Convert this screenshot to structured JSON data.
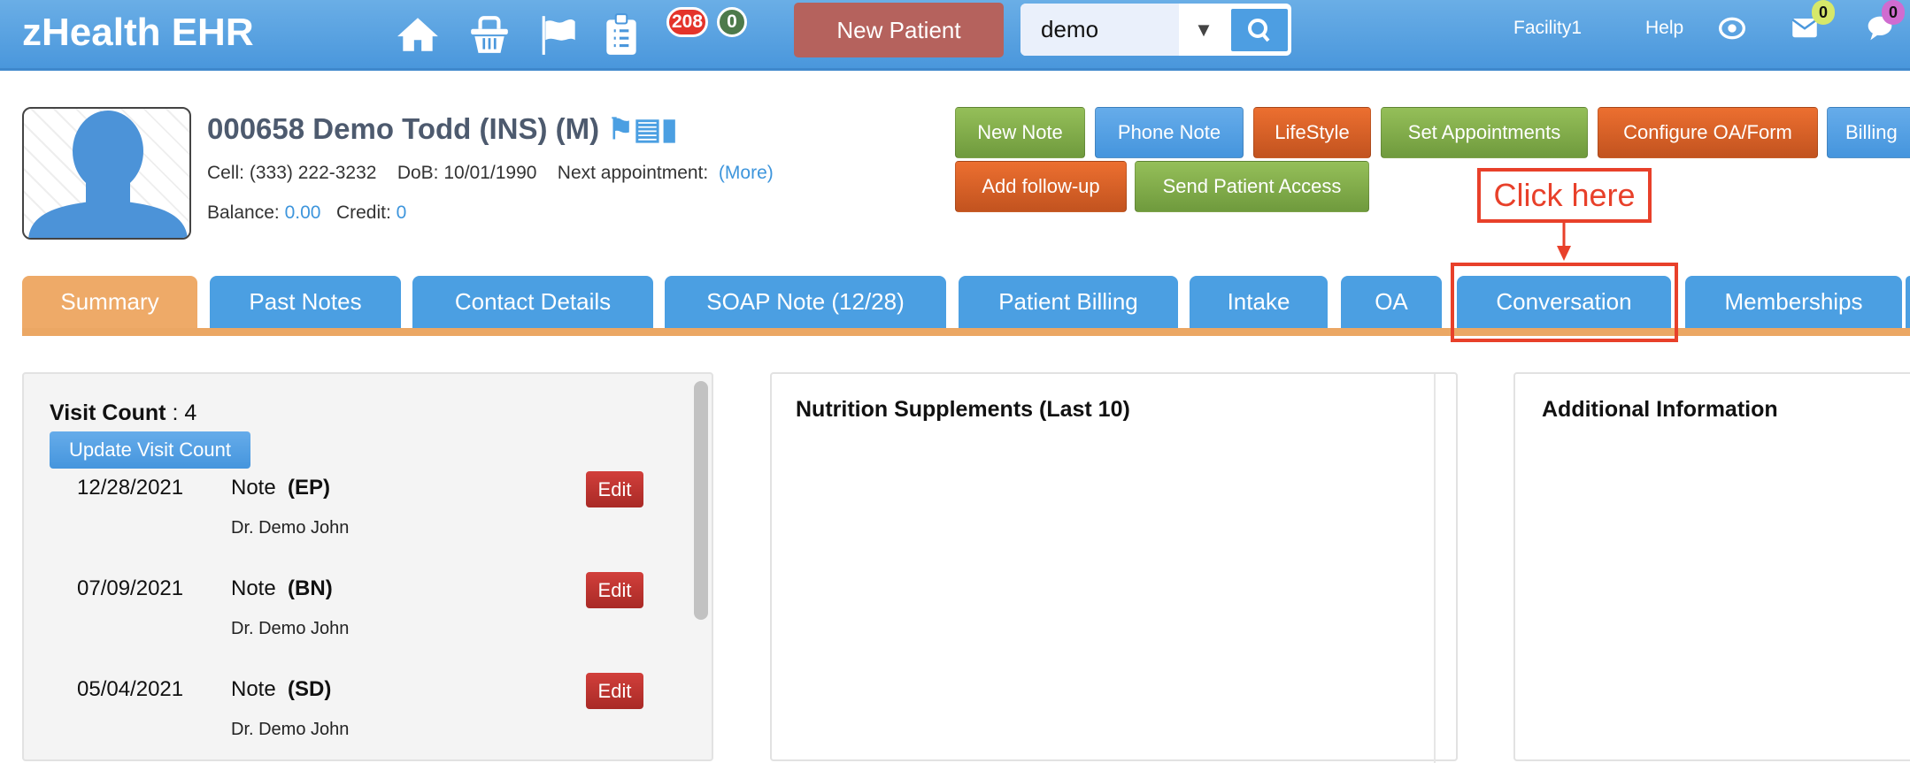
{
  "header": {
    "logo": "zHealth EHR",
    "icons": [
      "home-icon",
      "basket-icon",
      "flag-icon",
      "clipboard-icon"
    ],
    "badge_red": "208",
    "badge_green": "0",
    "new_patient": "New Patient",
    "search": {
      "value": "demo",
      "placeholder": ""
    },
    "facility": "Facility1",
    "help": "Help",
    "mail_count": "0",
    "chat_count": "0"
  },
  "patient": {
    "name": "000658 Demo Todd  (INS) (M)",
    "cell_label": "Cell:",
    "cell": "(333) 222-3232",
    "dob_label": "DoB:",
    "dob": "10/01/1990",
    "next_label": "Next appointment:",
    "more": "(More)",
    "balance_label": "Balance:",
    "balance": "0.00",
    "credit_label": "Credit:",
    "credit": "0"
  },
  "actions": [
    "New Note",
    "Phone Note",
    "LifeStyle",
    "Set Appointments",
    "Configure OA/Form",
    "Billing",
    "Add follow-up",
    "Send Patient Access"
  ],
  "tabs": [
    "Summary",
    "Past Notes",
    "Contact Details",
    "SOAP Note (12/28)",
    "Patient Billing",
    "Intake",
    "OA",
    "Conversation",
    "Memberships"
  ],
  "annotation": "Click here",
  "visits": {
    "label": "Visit Count",
    "count": ": 4",
    "update": "Update Visit Count",
    "rows": [
      {
        "date": "12/28/2021",
        "note": "Note",
        "code": "(EP)",
        "doctor": "Dr. Demo John",
        "edit": "Edit"
      },
      {
        "date": "07/09/2021",
        "note": "Note",
        "code": "(BN)",
        "doctor": "Dr. Demo John",
        "edit": "Edit"
      },
      {
        "date": "05/04/2021",
        "note": "Note",
        "code": "(SD)",
        "doctor": "Dr. Demo John",
        "edit": "Edit"
      }
    ]
  },
  "nutrition": {
    "title": "Nutrition Supplements (Last 10)"
  },
  "additional": {
    "title": "Additional Information"
  },
  "colors": {
    "topbar": "#4a97dc",
    "tab": "#4b9fe2",
    "active_tab": "#eeaa68",
    "annotation": "#e8402a"
  }
}
